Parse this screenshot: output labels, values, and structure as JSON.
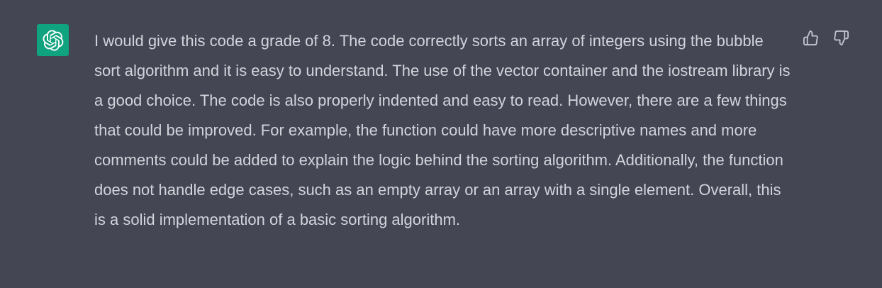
{
  "message": {
    "author_icon": "openai-logo-icon",
    "text": "I would give this code a grade of 8. The code correctly sorts an array of integers using the bubble sort algorithm and it is easy to understand. The use of the vector container and the iostream library is a good choice. The code is also properly indented and easy to read. However, there are a few things that could be improved. For example, the function could have more descriptive names and more comments could be added to explain the logic behind the sorting algorithm. Additionally, the function does not handle edge cases, such as an empty array or an array with a single element. Overall, this is a solid implementation of a basic sorting algorithm."
  },
  "actions": {
    "thumbs_up_icon": "thumbs-up-icon",
    "thumbs_down_icon": "thumbs-down-icon"
  },
  "colors": {
    "background": "#444654",
    "avatar": "#10a37f",
    "text": "#d1d5db",
    "icon": "#c5c5d2"
  }
}
